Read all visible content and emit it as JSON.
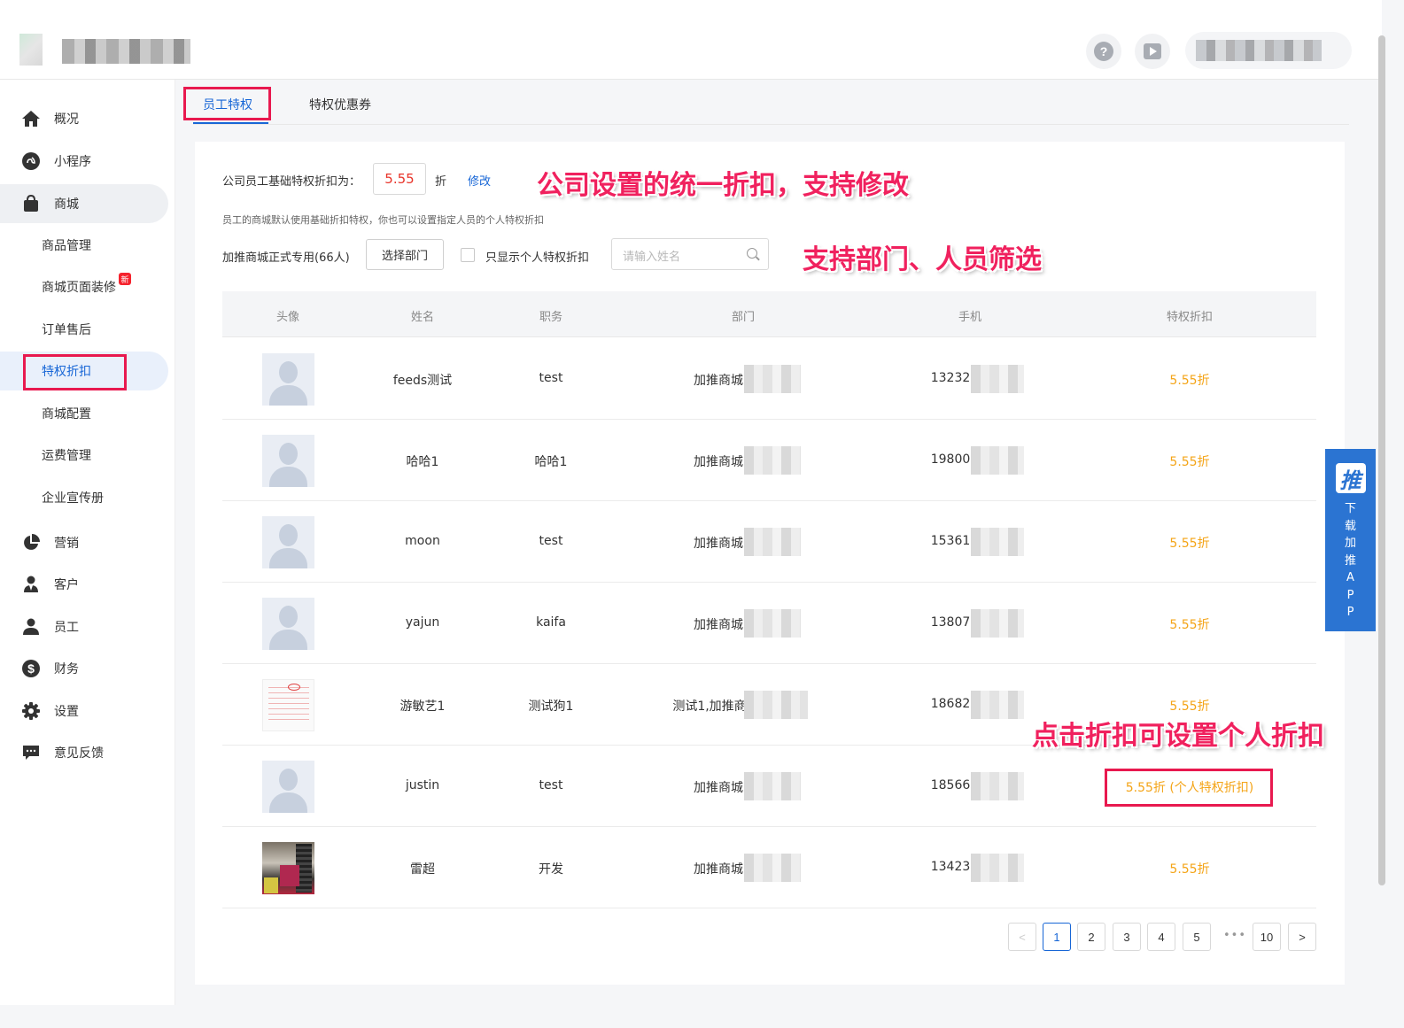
{
  "header": {
    "help_icon": "?",
    "video_icon": "play"
  },
  "sidebar": {
    "items": [
      {
        "label": "概况",
        "icon": "home-icon"
      },
      {
        "label": "小程序",
        "icon": "miniprogram-icon"
      },
      {
        "label": "商城",
        "icon": "shopping-bag-icon"
      },
      {
        "label": "商品管理"
      },
      {
        "label": "商城页面装修",
        "badge": "新"
      },
      {
        "label": "订单售后"
      },
      {
        "label": "特权折扣"
      },
      {
        "label": "商城配置"
      },
      {
        "label": "运费管理"
      },
      {
        "label": "企业宣传册"
      },
      {
        "label": "营销",
        "icon": "pie-chart-icon"
      },
      {
        "label": "客户",
        "icon": "customer-icon"
      },
      {
        "label": "员工",
        "icon": "employee-icon"
      },
      {
        "label": "财务",
        "icon": "dollar-icon"
      },
      {
        "label": "设置",
        "icon": "gear-icon"
      },
      {
        "label": "意见反馈",
        "icon": "feedback-icon"
      }
    ]
  },
  "tabs": [
    {
      "label": "员工特权",
      "active": true
    },
    {
      "label": "特权优惠券",
      "active": false
    }
  ],
  "settings": {
    "base_label": "公司员工基础特权折扣为：",
    "base_value": "5.55",
    "unit": "折",
    "edit_link": "修改",
    "hint": "员工的商城默认使用基础折扣特权，你也可以设置指定人员的个人特权折扣"
  },
  "filters": {
    "dept_label": "加推商城正式专用(66人)",
    "select_dept_button": "选择部门",
    "only_personal_label": "只显示个人特权折扣",
    "search_placeholder": "请输入姓名"
  },
  "annotations": {
    "a1": "公司设置的统一折扣，支持修改",
    "a2": "支持部门、人员筛选",
    "a3": "点击折扣可设置个人折扣"
  },
  "table": {
    "columns": [
      "头像",
      "姓名",
      "职务",
      "部门",
      "手机",
      "特权折扣"
    ],
    "rows": [
      {
        "name": "feeds测试",
        "title": "test",
        "dept": "加推商城",
        "phone": "13232",
        "discount": "5.55折",
        "avatar": "default"
      },
      {
        "name": "哈哈1",
        "title": "哈哈1",
        "dept": "加推商城",
        "phone": "19800",
        "discount": "5.55折",
        "avatar": "default"
      },
      {
        "name": "moon",
        "title": "test",
        "dept": "加推商城",
        "phone": "15361",
        "discount": "5.55折",
        "avatar": "default"
      },
      {
        "name": "yajun",
        "title": "kaifa",
        "dept": "加推商城",
        "phone": "13807",
        "discount": "5.55折",
        "avatar": "default"
      },
      {
        "name": "游敏艺1",
        "title": "测试狗1",
        "dept": "测试1,加推商",
        "phone": "18682",
        "discount": "5.55折",
        "avatar": "document"
      },
      {
        "name": "justin",
        "title": "test",
        "dept": "加推商城",
        "phone": "18566",
        "discount": "5.55折 (个人特权折扣)",
        "avatar": "default"
      },
      {
        "name": "雷超",
        "title": "开发",
        "dept": "加推商城",
        "phone": "13423",
        "discount": "5.55折",
        "avatar": "photo"
      }
    ]
  },
  "pagination": {
    "prev": "<",
    "pages": [
      "1",
      "2",
      "3",
      "4",
      "5"
    ],
    "ellipsis": "•••",
    "last": "10",
    "next": ">",
    "current": "1"
  },
  "app_promo": {
    "logo": "推",
    "text": "下载加推APP"
  },
  "colors": {
    "primary": "#1766d6",
    "discount": "#f4a417",
    "annotation": "#f0215e",
    "highlight_box": "#e8194f"
  }
}
